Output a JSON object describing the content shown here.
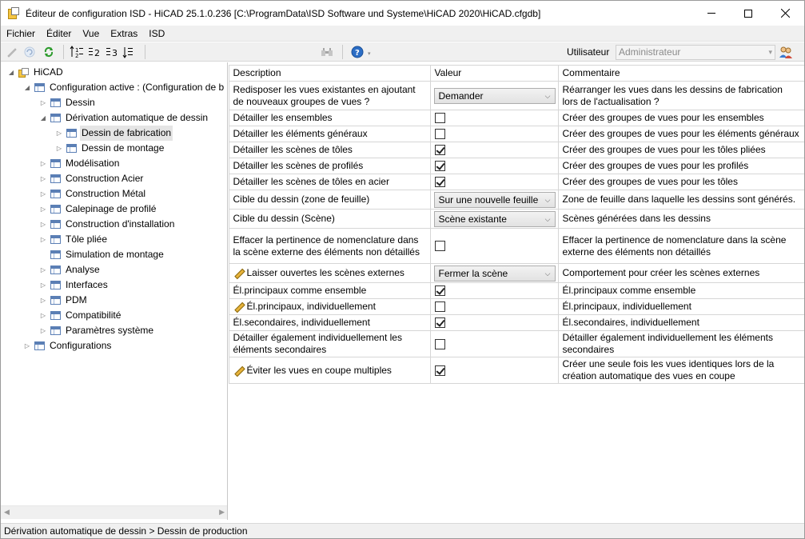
{
  "window": {
    "title": "Éditeur de configuration ISD  - HiCAD 25.1.0.236 [C:\\ProgramData\\ISD Software und Systeme\\HiCAD 2020\\HiCAD.cfgdb]"
  },
  "menu": [
    "Fichier",
    "Éditer",
    "Vue",
    "Extras",
    "ISD"
  ],
  "toolbar": {
    "user_label": "Utilisateur",
    "user_value": "Administrateur"
  },
  "tree": [
    {
      "label": "HiCAD",
      "exp": "◢",
      "icon": "root"
    },
    {
      "label": "Configuration active : (Configuration de b",
      "exp": "◢",
      "icon": "grid"
    },
    {
      "label": "Dessin",
      "exp": "▷",
      "icon": "grid"
    },
    {
      "label": "Dérivation automatique de dessin",
      "exp": "◢",
      "icon": "grid"
    },
    {
      "label": "Dessin de fabrication",
      "exp": "▷",
      "icon": "grid",
      "selected": true
    },
    {
      "label": "Dessin de montage",
      "exp": "▷",
      "icon": "grid"
    },
    {
      "label": "Modélisation",
      "exp": "▷",
      "icon": "grid"
    },
    {
      "label": "Construction Acier",
      "exp": "▷",
      "icon": "grid"
    },
    {
      "label": "Construction Métal",
      "exp": "▷",
      "icon": "grid"
    },
    {
      "label": "Calepinage de profilé",
      "exp": "▷",
      "icon": "grid"
    },
    {
      "label": "Construction d'installation",
      "exp": "▷",
      "icon": "grid"
    },
    {
      "label": "Tôle pliée",
      "exp": "▷",
      "icon": "grid"
    },
    {
      "label": "Simulation de montage",
      "exp": "",
      "icon": "grid"
    },
    {
      "label": "Analyse",
      "exp": "▷",
      "icon": "grid"
    },
    {
      "label": "Interfaces",
      "exp": "▷",
      "icon": "grid"
    },
    {
      "label": "PDM",
      "exp": "▷",
      "icon": "grid"
    },
    {
      "label": "Compatibilité",
      "exp": "▷",
      "icon": "grid"
    },
    {
      "label": "Paramètres système",
      "exp": "▷",
      "icon": "grid"
    },
    {
      "label": "Configurations",
      "exp": "▷",
      "icon": "grid"
    }
  ],
  "grid": {
    "headers": [
      "Description",
      "Valeur",
      "Commentaire"
    ],
    "rows": [
      {
        "desc": "Redisposer les vues existantes en ajoutant de nouveaux groupes de vues ?",
        "type": "dropdown",
        "value": "Demander",
        "comment": "Réarranger les vues dans les dessins de fabrication lors de l'actualisation ?",
        "pencil": false
      },
      {
        "desc": "Détailler les ensembles",
        "type": "checkbox",
        "checked": false,
        "comment": "Créer des groupes de vues pour les ensembles",
        "pencil": false
      },
      {
        "desc": "Détailler les éléments généraux",
        "type": "checkbox",
        "checked": false,
        "comment": "Créer des groupes de vues pour les éléments généraux",
        "pencil": false
      },
      {
        "desc": "Détailler les scènes de tôles",
        "type": "checkbox",
        "checked": true,
        "comment": "Créer des groupes de vues pour les tôles pliées",
        "pencil": false
      },
      {
        "desc": "Détailler les scènes de profilés",
        "type": "checkbox",
        "checked": true,
        "comment": "Créer des groupes de vues pour les profilés",
        "pencil": false
      },
      {
        "desc": "Détailler les scènes de tôles en acier",
        "type": "checkbox",
        "checked": true,
        "comment": "Créer des groupes de vues pour les tôles",
        "pencil": false
      },
      {
        "desc": "Cible du dessin (zone de feuille)",
        "type": "dropdown",
        "value": "Sur une nouvelle feuille",
        "comment": "Zone de feuille dans laquelle les dessins sont générés.",
        "pencil": false
      },
      {
        "desc": "Cible du dessin (Scène)",
        "type": "dropdown",
        "value": "Scène existante",
        "comment": "Scènes générées dans les dessins",
        "pencil": false
      },
      {
        "desc": "Effacer la pertinence de nomenclature dans la scène externe des éléments non détaillés",
        "type": "checkbox",
        "checked": false,
        "comment": "Effacer la pertinence de nomenclature dans la scène externe des éléments non détaillés",
        "pencil": false
      },
      {
        "desc": "Laisser ouvertes les scènes externes",
        "type": "dropdown",
        "value": "Fermer la scène",
        "comment": "Comportement pour créer les scènes externes",
        "pencil": true
      },
      {
        "desc": "Él.principaux comme ensemble",
        "type": "checkbox",
        "checked": true,
        "comment": "Él.principaux comme ensemble",
        "pencil": false
      },
      {
        "desc": "Él.principaux, individuellement",
        "type": "checkbox",
        "checked": false,
        "comment": "Él.principaux, individuellement",
        "pencil": true
      },
      {
        "desc": "Él.secondaires, individuellement",
        "type": "checkbox",
        "checked": true,
        "comment": "Él.secondaires, individuellement",
        "pencil": false
      },
      {
        "desc": "Détailler également individuellement les éléments secondaires",
        "type": "checkbox",
        "checked": false,
        "comment": "Détailler également individuellement les éléments secondaires",
        "pencil": false
      },
      {
        "desc": "Éviter les vues en coupe multiples",
        "type": "checkbox",
        "checked": true,
        "comment": "Créer  une seule fois les vues identiques lors de la création automatique des vues en coupe",
        "pencil": true
      }
    ]
  },
  "statusbar": {
    "text": "Dérivation automatique de dessin > Dessin de production"
  }
}
